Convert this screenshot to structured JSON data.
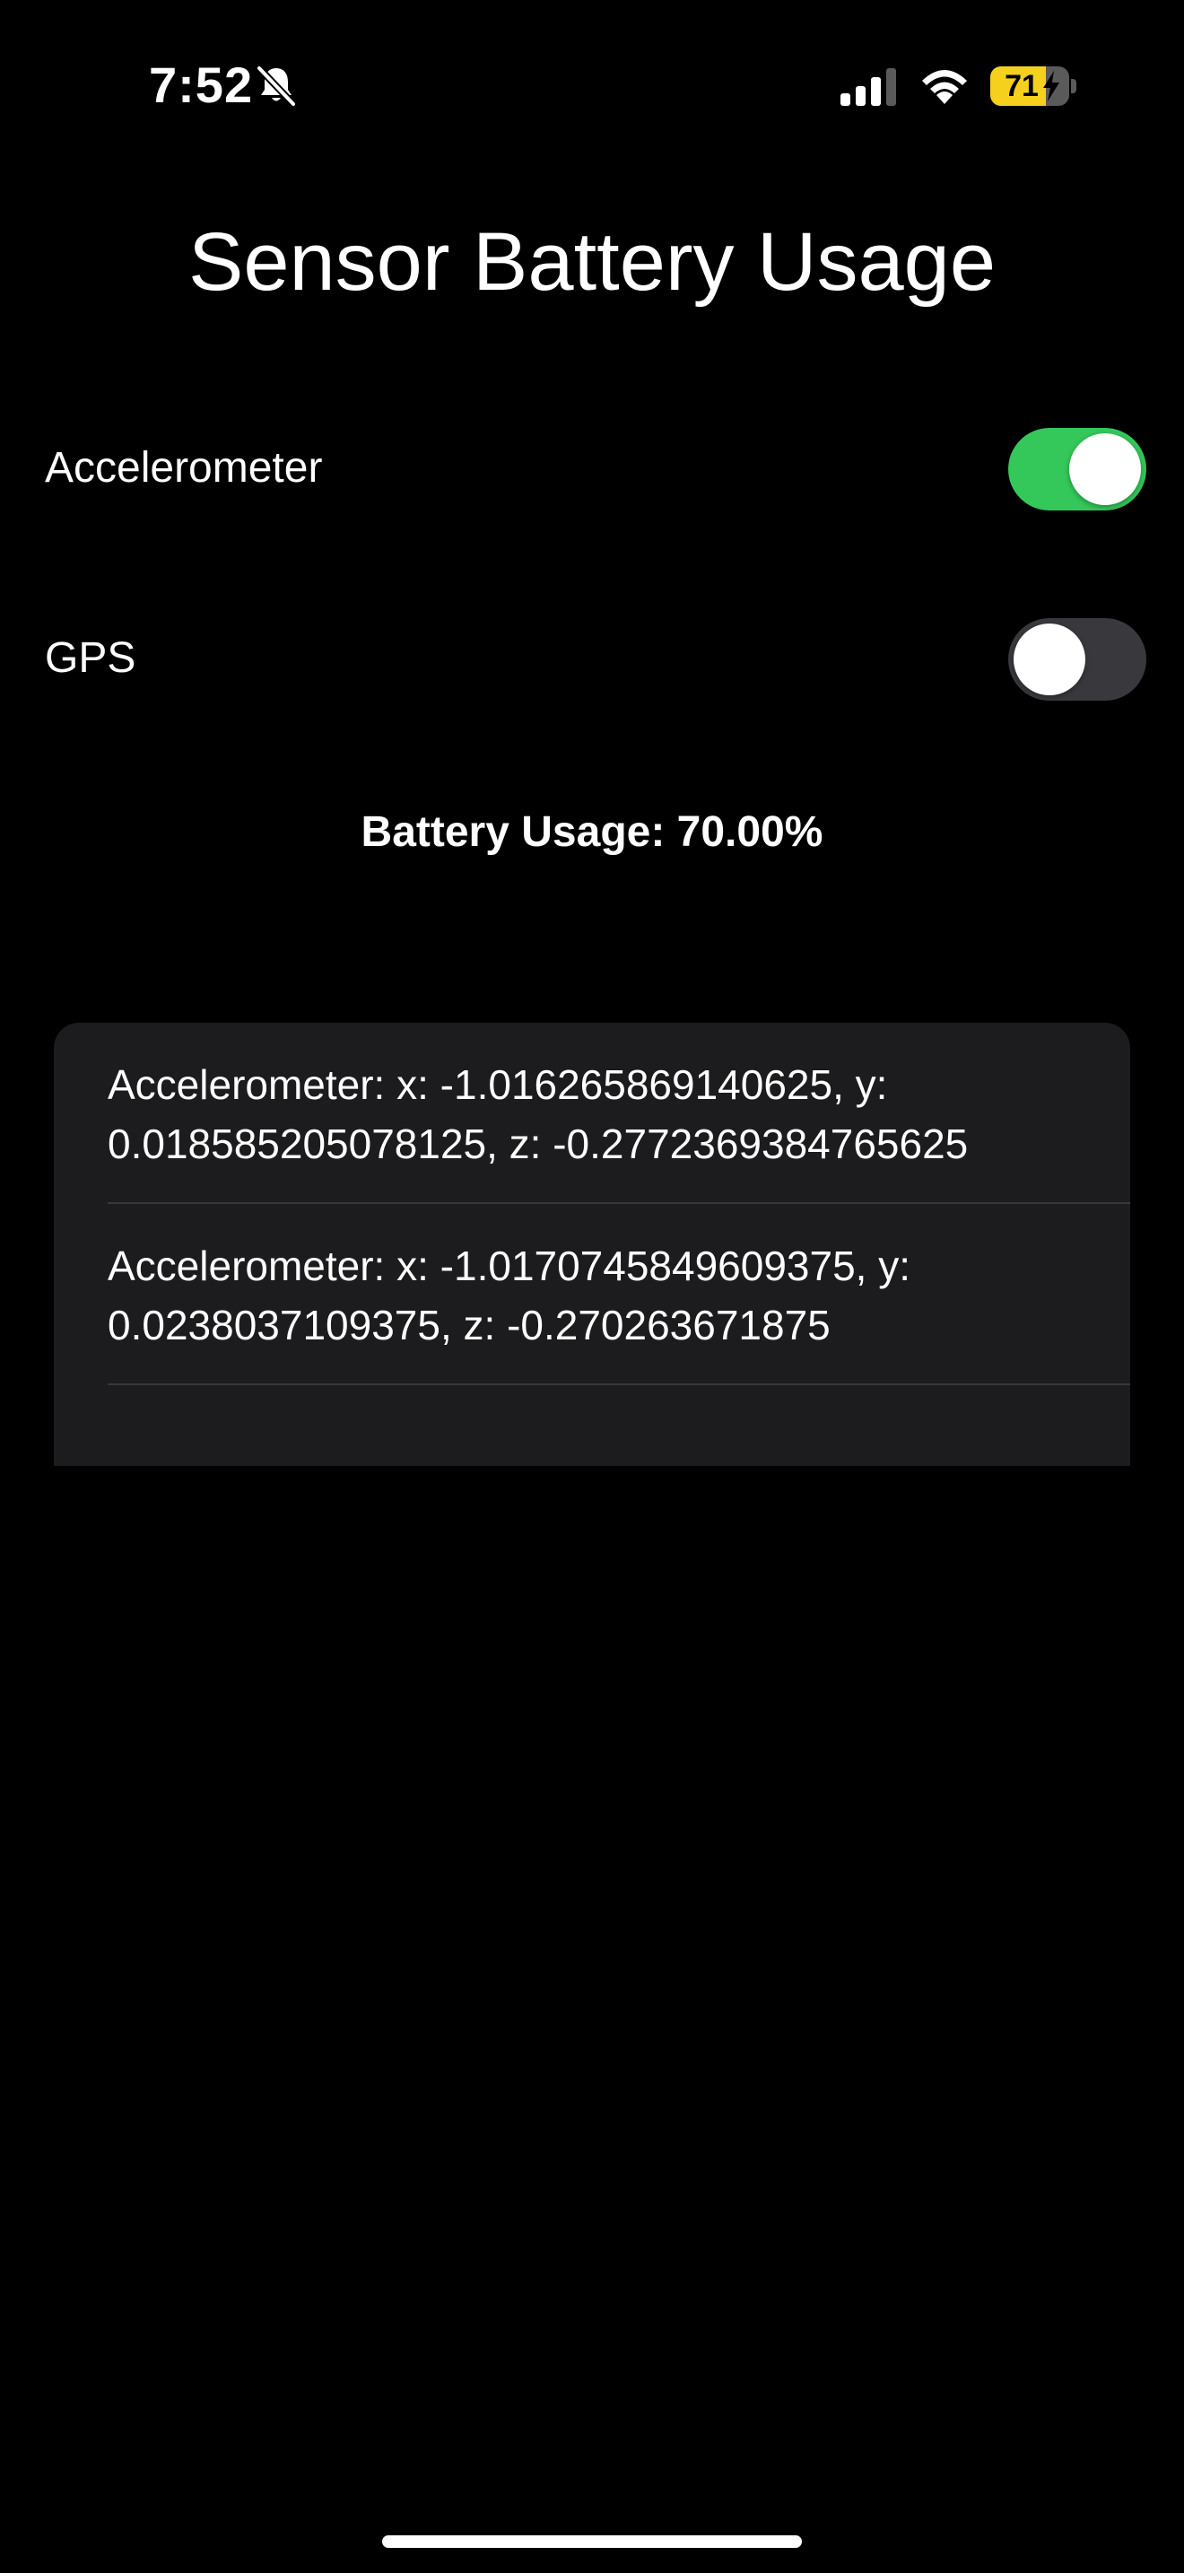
{
  "status_bar": {
    "time": "7:52",
    "battery_level": "71",
    "battery_percent": 71,
    "battery_charging": true,
    "icons": [
      "bell-slash-icon",
      "cellular-signal-icon",
      "wifi-icon",
      "battery-icon",
      "bolt-icon"
    ]
  },
  "page": {
    "title": "Sensor Battery Usage"
  },
  "toggles": [
    {
      "label": "Accelerometer",
      "on": true
    },
    {
      "label": "GPS",
      "on": false
    }
  ],
  "battery_usage": {
    "text": "Battery Usage: 70.00%"
  },
  "readings": [
    {
      "text": "Accelerometer: x: -1.016265869140625, y: 0.018585205078125, z: -0.2772369384765625"
    },
    {
      "text": "Accelerometer: x: -1.0170745849609375, y: 0.0238037109375, z: -0.270263671875"
    }
  ],
  "colors": {
    "background": "#000000",
    "toggle_on": "#34c759",
    "toggle_off": "#39393d",
    "card": "#1c1c1e",
    "battery": "#f5d11d"
  }
}
